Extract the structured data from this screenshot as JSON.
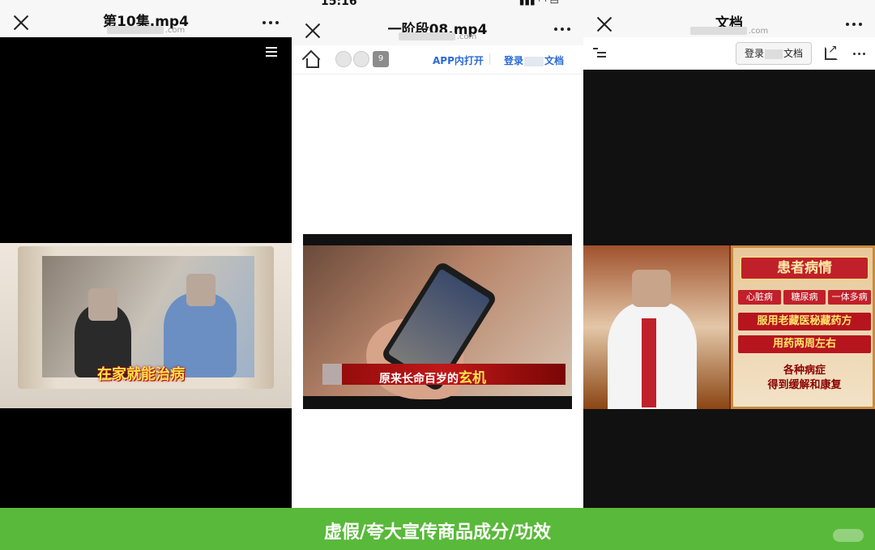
{
  "panel1": {
    "title": "第10集.mp4",
    "domain_suffix": ".com",
    "caption": "在家就能治病"
  },
  "panel2": {
    "status_time": "15:16",
    "title": "一阶段08.mp4",
    "domain_suffix": ".com",
    "count_badge": "9",
    "app_open": "APP内打开",
    "login_prefix": "登录",
    "login_suffix": "文档",
    "caption_main": "原来长命百岁的",
    "caption_highlight": "玄机"
  },
  "panel3": {
    "title": "文档",
    "domain_suffix": ".com",
    "login_prefix": "登录",
    "login_suffix": "文档",
    "poster_title": "患者病情",
    "tags": [
      "心脏病",
      "糖尿病",
      "一体多病"
    ],
    "line1": "服用老藏医秘藏药方",
    "line2": "用药两周左右",
    "footer1": "各种病症",
    "footer2": "得到缓解和康复"
  },
  "bottom": {
    "label": "虚假/夸大宣传商品成分/功效"
  },
  "colors": {
    "bottom_bar": "#59b93a",
    "link_blue": "#2a6ad6",
    "banner_red": "#c0202a"
  }
}
